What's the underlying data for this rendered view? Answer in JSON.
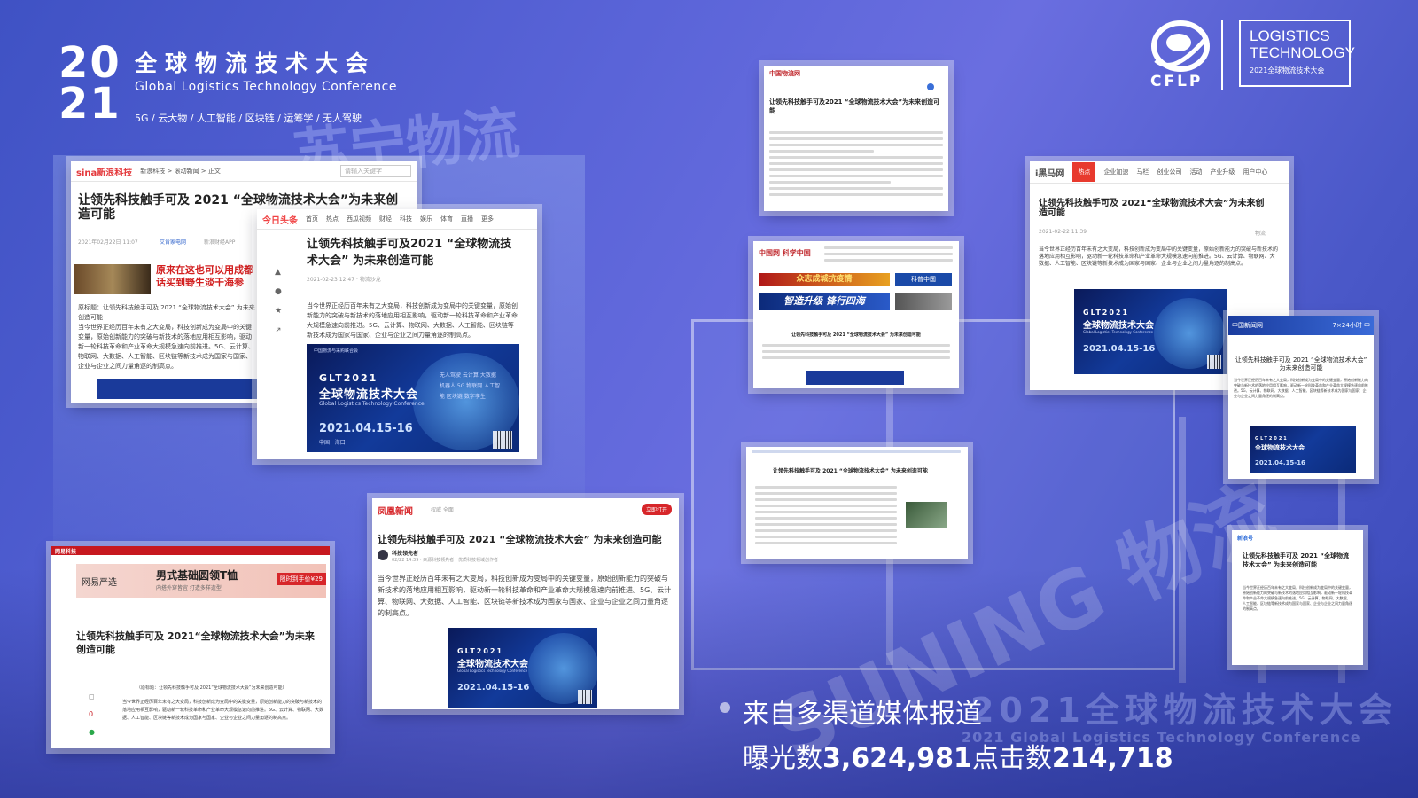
{
  "header": {
    "year_top": "20",
    "year_bottom": "21",
    "title": "全球物流技术大会",
    "subtitle": "Global Logistics Technology Conference",
    "tags": "5G / 云大物 / 人工智能 / 区块链 / 运筹学 / 无人驾驶"
  },
  "logo": {
    "cflp": "CFLP",
    "box_line1": "LOGISTICS",
    "box_line2": "TECHNOLOGY",
    "box_line3": "2021全球物流技术大会"
  },
  "background": {
    "store_text": "苏宁物流",
    "wall_text": "2021全球物流技术大会",
    "wall_sub": "2021 Global Logistics Technology Conference",
    "floor_text": "SUNING 物流"
  },
  "article_title": "让领先科技触手可及 2021“全球物流技术大会”为未来创造可能",
  "article_para": "当今世界正经历百年未有之大变局，科技创新成为变局中的关键变量，原始创新能力的突破与新技术的落地应用相互影响，驱动新一轮科技革命和产业革命大规模急速向前推进。5G、云计算、物联网、大数据、人工智能、区块链等新技术成为国家与国家、企业与企业之间力量角逐的制高点。",
  "banner": {
    "glt": "GLT2021",
    "title": "全球物流技术大会",
    "en": "Global Logistics Technology Conference",
    "date": "2021.04.15-16",
    "place": "中国 · 海口",
    "org": "中国物流与采购联合会",
    "side": "无人驾驶 云计算 大数据 机器人 5G 物联网 人工智能 区块链 数字孪生"
  },
  "cards": {
    "sina": {
      "logo": "sina新浪科技",
      "nav": "新浪科技 > 滚动新闻 > 正文",
      "search_placeholder": "请输入关键字",
      "title": "让领先科技触手可及 2021 “全球物流技术大会”为未来创造可能",
      "date": "2021年02月22日 11:07",
      "source": "艾肯家电网",
      "app": "新浪财经APP",
      "ad": "原来在这也可以用成都话买到野生淡干海参",
      "orig": "原标题：让领先科技触手可及 2021 “全球物流技术大会” 为未来创造可能"
    },
    "toutiao": {
      "logo": "今日头条",
      "nav": [
        "首页",
        "热点",
        "西瓜视频",
        "财经",
        "科技",
        "娱乐",
        "体育",
        "直播",
        "更多"
      ],
      "title": "让领先科技触手可及2021 “全球物流技术大会” 为未来创造可能",
      "meta": "2021-02-23 12:47 · 物流沙龙"
    },
    "china_logistics": {
      "logo": "中国物流网",
      "title": "让领先科技触手可及2021 “全球物流技术大会”为未来创造可能"
    },
    "kepu": {
      "logo": "中国网 科学中国",
      "banner1": "众志成城抗疫情",
      "banner2": "科普中国",
      "banner3": "智造升级 锋行四海",
      "title": "让领先科技触手可及 2021 “全球物流技术大会” 为未来创造可能"
    },
    "heima": {
      "logo": "i黑马网",
      "nav": [
        "热点",
        "企业加速",
        "马栏",
        "创业公司",
        "活动",
        "产业升级",
        "用户中心"
      ],
      "title": "让领先科技触手可及 2021“全球物流技术大会”为未来创造可能",
      "date": "2021-02-22 11:39",
      "tag": "物流"
    },
    "chinanews": {
      "logo": "中国新闻网",
      "slogan": "7×24小时 中",
      "title": "让领先科技触手可及 2021 “全球物流技术大会” 为未来创造可能"
    },
    "sohu": {
      "title": "让领先科技触手可及 2021 “全球物流技术大会” 为未来创造可能"
    },
    "ifeng": {
      "logo": "凤凰新闻",
      "tagline": "权威 全面",
      "open": "立即打开",
      "title": "让领先科技触手可及 2021 “全球物流技术大会” 为未来创造可能",
      "author": "科技领先者",
      "meta": "02/22 14:39 · 来源科技领先者 · 优质科技领域创作者"
    },
    "netease": {
      "logo": "网易科技",
      "ad_brand": "网易严选",
      "ad_title": "男式基础圆领T恤",
      "ad_sub": "内搭外穿皆宜 打造多样造型",
      "ad_price": "限时到手价¥29",
      "title": "让领先科技触手可及 2021“全球物流技术大会”为未来创造可能",
      "orig": "（原标题：让领先科技触手可及 2021“全球物流技术大会”为未来创造可能）"
    },
    "xinlang": {
      "logo": "新浪号",
      "title": "让领先科技触手可及 2021 “全球物流技术大会” 为未来创造可能"
    }
  },
  "caption": {
    "line1": "来自多渠道媒体报道",
    "exposure_label": "曝光数",
    "exposure_value": "3,624,981",
    "click_label": "点击数",
    "click_value": "214,718"
  },
  "colors": {
    "sina_red": "#e4393c",
    "toutiao_red": "#f04142",
    "banner_blue": "#123a9a",
    "ifeng_red": "#d7262a"
  }
}
